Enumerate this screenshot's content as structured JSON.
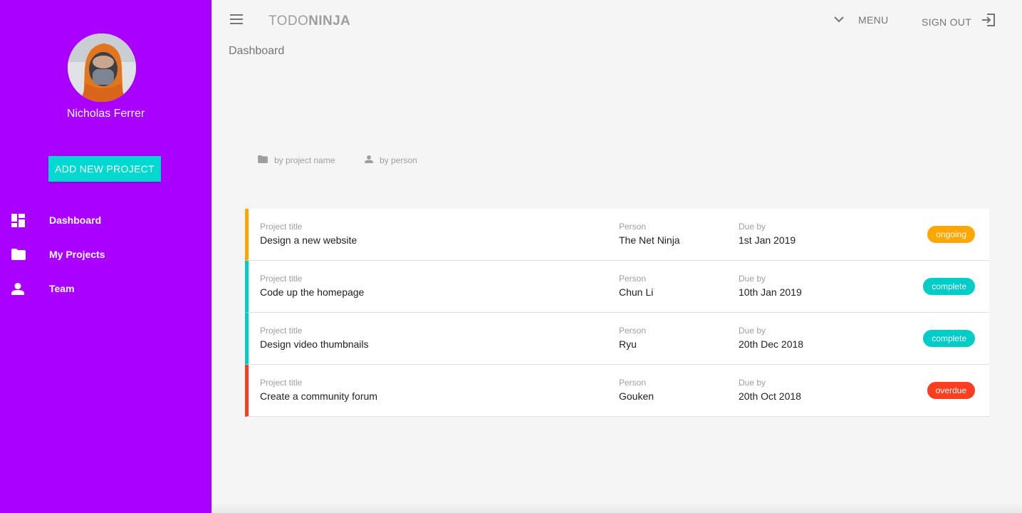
{
  "sidebar": {
    "user_name": "Nicholas Ferrer",
    "add_button_label": "ADD NEW PROJECT",
    "items": [
      {
        "label": "Dashboard",
        "icon": "dashboard-icon"
      },
      {
        "label": "My Projects",
        "icon": "folder-icon"
      },
      {
        "label": "Team",
        "icon": "person-icon"
      }
    ],
    "background_color": "#aa00ff",
    "accent_color": "#00d8d0"
  },
  "toolbar": {
    "brand_light": "TODO",
    "brand_bold": "NINJA",
    "menu_label": "MENU",
    "signout_label": "SIGN OUT"
  },
  "page": {
    "title": "Dashboard"
  },
  "sort": {
    "by_project": "by project name",
    "by_person": "by person"
  },
  "projects": {
    "captions": {
      "title": "Project title",
      "person": "Person",
      "due": "Due by"
    },
    "rows": [
      {
        "title": "Design a new website",
        "person": "The Net Ninja",
        "due": "1st Jan 2019",
        "status": "ongoing"
      },
      {
        "title": "Code up the homepage",
        "person": "Chun Li",
        "due": "10th Jan 2019",
        "status": "complete"
      },
      {
        "title": "Design video thumbnails",
        "person": "Ryu",
        "due": "20th Dec 2018",
        "status": "complete"
      },
      {
        "title": "Create a community forum",
        "person": "Gouken",
        "due": "20th Oct 2018",
        "status": "overdue"
      }
    ],
    "status_colors": {
      "ongoing": "#ffa600",
      "complete": "#00ccc8",
      "overdue": "#f83e1f"
    }
  }
}
